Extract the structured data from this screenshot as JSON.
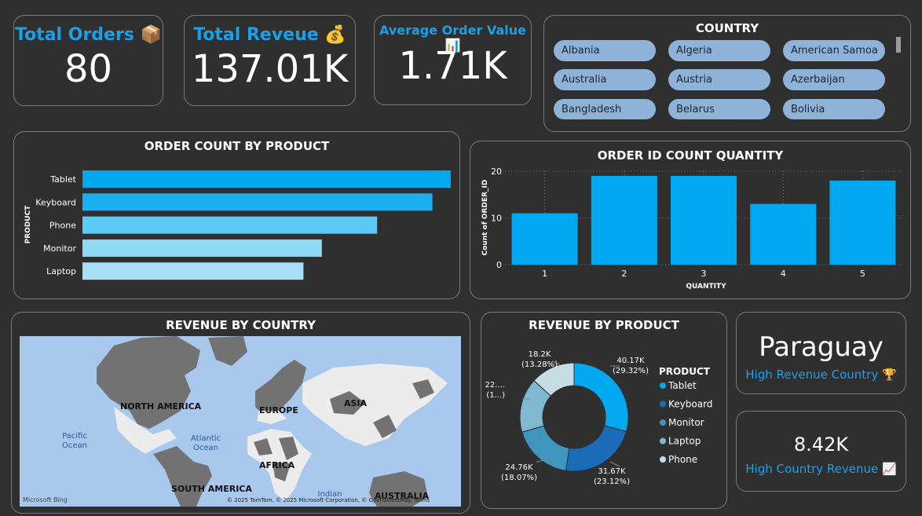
{
  "kpis": {
    "total_orders": {
      "label": "Total Orders",
      "icon": "📦",
      "value": "80"
    },
    "total_revenue": {
      "label": "Total Reveue",
      "icon": "💰",
      "value": "137.01K"
    },
    "avg_order": {
      "label": "Average Order Value",
      "icon": "📊",
      "value": "1.71K"
    }
  },
  "country_slicer": {
    "title": "COUNTRY",
    "items": [
      "Albania",
      "Algeria",
      "American Samoa",
      "Australia",
      "Austria",
      "Azerbaijan",
      "Bangladesh",
      "Belarus",
      "Bolivia"
    ]
  },
  "order_count_chart": {
    "title": "ORDER COUNT BY PRODUCT",
    "ylabel": "PRODUCT",
    "chart_data": {
      "type": "bar",
      "categories": [
        "Tablet",
        "Keyboard",
        "Phone",
        "Monitor",
        "Laptop"
      ],
      "values": [
        20,
        19,
        16,
        13,
        12
      ],
      "colors": [
        "#00a8f0",
        "#1db0f0",
        "#5ccaf5",
        "#8fd8f6",
        "#a8def7"
      ]
    }
  },
  "qty_chart": {
    "title": "ORDER ID COUNT QUANTITY",
    "xlabel": "QUANTITY",
    "ylabel": "Count of ORDER_ID",
    "chart_data": {
      "type": "bar",
      "categories": [
        "1",
        "2",
        "3",
        "4",
        "5"
      ],
      "values": [
        11,
        19,
        19,
        13,
        18
      ],
      "ylim": [
        0,
        20
      ],
      "yticks": [
        "0",
        "10",
        "20"
      ]
    }
  },
  "map": {
    "title": "REVENUE BY COUNTRY",
    "labels": {
      "na": "NORTH AMERICA",
      "eu": "EUROPE",
      "as": "ASIA",
      "af": "AFRICA",
      "sa": "SOUTH AMERICA",
      "au": "AUSTRALIA",
      "pacific": "Pacific\nOcean",
      "atlantic": "Atlantic\nOcean",
      "indian": "Indian"
    },
    "bing": "Microsoft Bing",
    "credits": "© 2025 TomTom, © 2025 Microsoft Corporation, © OpenStreetMap  Terms"
  },
  "revenue_product": {
    "title": "REVENUE BY PRODUCT",
    "legend_title": "PRODUCT",
    "chart_data": {
      "type": "pie",
      "categories": [
        "Tablet",
        "Keyboard",
        "Monitor",
        "Laptop",
        "Phone"
      ],
      "values": [
        29.32,
        23.12,
        18.07,
        16.21,
        13.28
      ],
      "colors": [
        "#00a8f0",
        "#1a6cb8",
        "#3f97c0",
        "#7fb8d1",
        "#c6dde6"
      ]
    },
    "labels": [
      {
        "value": "40.17K",
        "pct": "(29.32%)"
      },
      {
        "value": "31.67K",
        "pct": "(23.12%)"
      },
      {
        "value": "24.76K",
        "pct": "(18.07%)"
      },
      {
        "value": "22....",
        "pct": "(1...)"
      },
      {
        "value": "18.2K",
        "pct": "(13.28%)"
      }
    ]
  },
  "top_country": {
    "value": "Paraguay",
    "label": "High Revenue Country",
    "icon": "🏆"
  },
  "top_revenue": {
    "value": "8.42K",
    "label": "High Country Revenue",
    "icon": "📈"
  }
}
